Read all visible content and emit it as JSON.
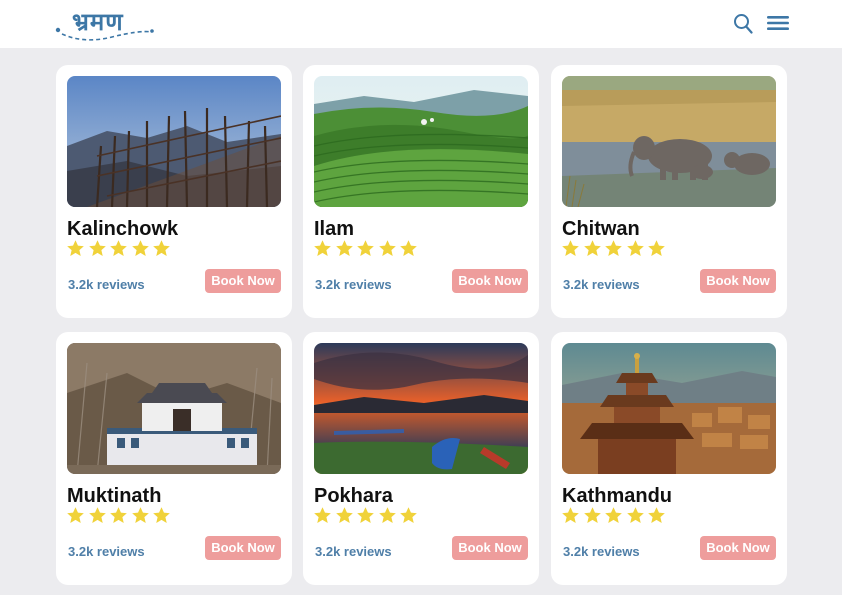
{
  "header": {
    "logo_text": "भ्रमण",
    "search_icon": "search-icon",
    "menu_icon": "hamburger-menu-icon"
  },
  "colors": {
    "brand": "#3d77a6",
    "star": "#f0d23a",
    "book_button": "#ee9d9c",
    "reviews_text": "#4f7fa8",
    "background": "#ececef"
  },
  "cards": [
    {
      "name": "Kalinchowk",
      "rating": 5,
      "reviews": "3.2k reviews",
      "button": "Book Now"
    },
    {
      "name": "Ilam",
      "rating": 5,
      "reviews": "3.2k reviews",
      "button": "Book Now"
    },
    {
      "name": "Chitwan",
      "rating": 5,
      "reviews": "3.2k reviews",
      "button": "Book Now"
    },
    {
      "name": "Muktinath",
      "rating": 5,
      "reviews": "3.2k reviews",
      "button": "Book Now"
    },
    {
      "name": "Pokhara",
      "rating": 5,
      "reviews": "3.2k reviews",
      "button": "Book Now"
    },
    {
      "name": "Kathmandu",
      "rating": 5,
      "reviews": "3.2k reviews",
      "button": "Book Now"
    }
  ]
}
